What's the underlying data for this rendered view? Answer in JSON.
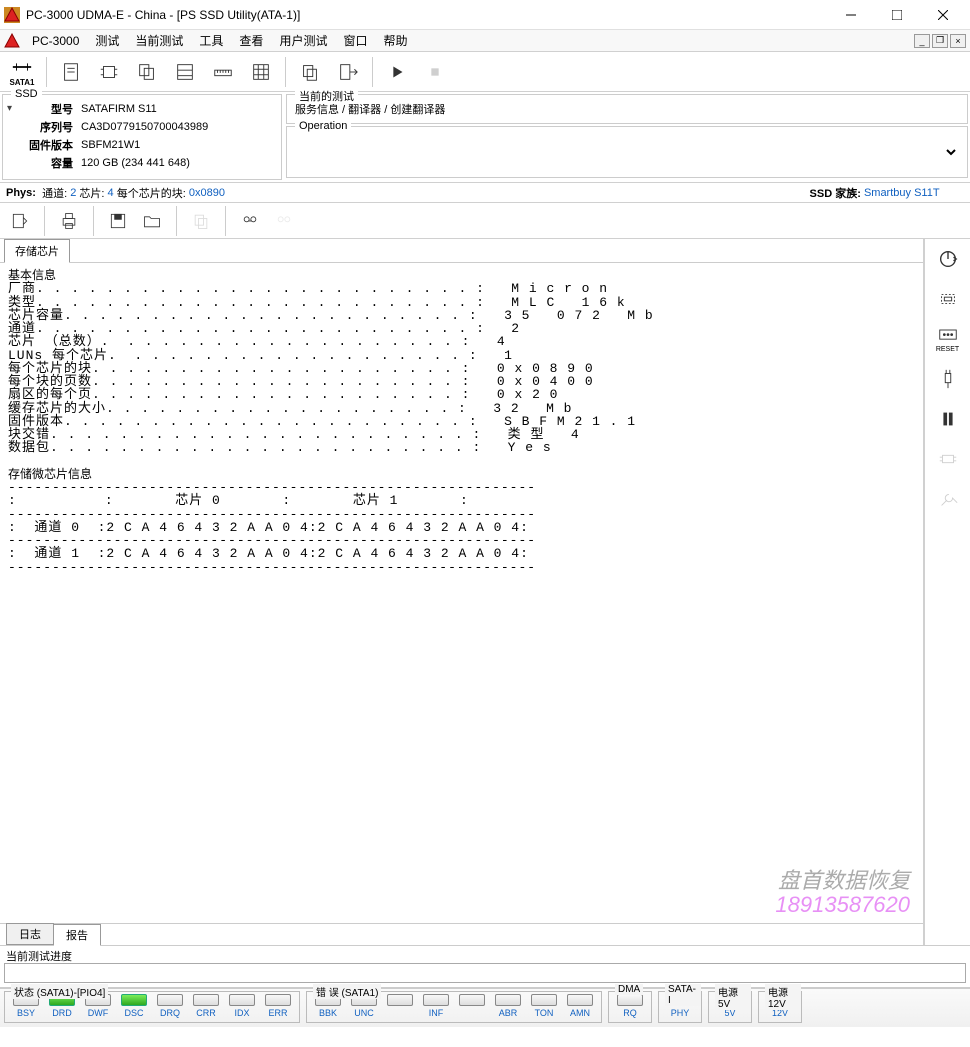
{
  "title": "PC-3000 UDMA-E - China - [PS SSD Utility(ATA-1)]",
  "menu": {
    "app": "PC-3000",
    "items": [
      "测试",
      "当前测试",
      "工具",
      "查看",
      "用户测试",
      "窗口",
      "帮助"
    ]
  },
  "toolbar": {
    "sata": "SATA1"
  },
  "ssd_panel": {
    "legend": "SSD",
    "rows": [
      {
        "label": "型号",
        "value": "SATAFIRM   S11"
      },
      {
        "label": "序列号",
        "value": "CA3D0779150700043989"
      },
      {
        "label": "固件版本",
        "value": "SBFM21W1"
      },
      {
        "label": "容量",
        "value": "120 GB (234 441 648)"
      }
    ]
  },
  "current_test": {
    "legend": "当前的测试",
    "crumb": "服务信息 / 翻译器 / 创建翻译器"
  },
  "operation": {
    "legend": "Operation",
    "value": ""
  },
  "phys": {
    "label": "Phys:",
    "ch_lbl": "通道:",
    "ch": "2",
    "chip_lbl": "芯片:",
    "chip": "4",
    "blocks_lbl": "每个芯片的块:",
    "blocks": "0x0890",
    "family_lbl": "SSD 家族:",
    "family": "Smartbuy S11T"
  },
  "tab_main": "存储芯片",
  "basic_hdr": "基本信息",
  "basic": [
    {
      "k": "厂商",
      "v": "Micron"
    },
    {
      "k": "类型",
      "v": "MLC 16k"
    },
    {
      "k": "芯片容量",
      "v": "35 072 Mb"
    },
    {
      "k": "通道",
      "v": "2"
    },
    {
      "k": "芯片 （总数）",
      "v": "4"
    },
    {
      "k": "LUNs 每个芯片",
      "v": "1"
    },
    {
      "k": "每个芯片的块",
      "v": "0x0890"
    },
    {
      "k": "每个块的页数",
      "v": "0x0400"
    },
    {
      "k": "扇区的每个页",
      "v": "0x20"
    },
    {
      "k": "缓存芯片的大小",
      "v": "32 Mb"
    },
    {
      "k": "固件版本",
      "v": "SBFM21.1"
    },
    {
      "k": "块交错",
      "v": "类型 4"
    },
    {
      "k": "数据包",
      "v": "Yes"
    }
  ],
  "mem_hdr": "存储微芯片信息",
  "mem_table": {
    "col_hdrs": [
      "",
      "芯片 0",
      "芯片 1"
    ],
    "rows": [
      {
        "r": "通道 0",
        "c": [
          "2CA46432AA04",
          "2CA46432AA04"
        ]
      },
      {
        "r": "通道 1",
        "c": [
          "2CA46432AA04",
          "2CA46432AA04"
        ]
      }
    ]
  },
  "side_reset": "RESET",
  "watermark": {
    "text": "盘首数据恢复",
    "phone": "18913587620"
  },
  "bottom_tabs": [
    "日志",
    "报告"
  ],
  "progress_label": "当前测试进度",
  "status": {
    "g1": {
      "legend": "状态 (SATA1)-[PIO4]",
      "leds": [
        {
          "lbl": "BSY",
          "on": false
        },
        {
          "lbl": "DRD",
          "on": true
        },
        {
          "lbl": "DWF",
          "on": false
        },
        {
          "lbl": "DSC",
          "on": true
        },
        {
          "lbl": "DRQ",
          "on": false
        },
        {
          "lbl": "CRR",
          "on": false
        },
        {
          "lbl": "IDX",
          "on": false
        },
        {
          "lbl": "ERR",
          "on": false
        }
      ]
    },
    "g2": {
      "legend": "错 误 (SATA1)",
      "leds": [
        {
          "lbl": "BBK",
          "on": false
        },
        {
          "lbl": "UNC",
          "on": false
        },
        {
          "lbl": "",
          "on": false
        },
        {
          "lbl": "INF",
          "on": false
        },
        {
          "lbl": "",
          "on": false
        },
        {
          "lbl": "ABR",
          "on": false
        },
        {
          "lbl": "TON",
          "on": false
        },
        {
          "lbl": "AMN",
          "on": false
        }
      ]
    },
    "g3": {
      "legend": "DMA",
      "leds": [
        {
          "lbl": "RQ",
          "on": false
        }
      ]
    },
    "g4": {
      "legend": "SATA-I",
      "leds": [
        {
          "lbl": "PHY",
          "on": true
        }
      ]
    },
    "g5": {
      "legend": "电源 5V",
      "leds": [
        {
          "lbl": "5V",
          "on": true
        }
      ]
    },
    "g6": {
      "legend": "电源 12V",
      "leds": [
        {
          "lbl": "12V",
          "on": "yellow"
        }
      ]
    }
  }
}
